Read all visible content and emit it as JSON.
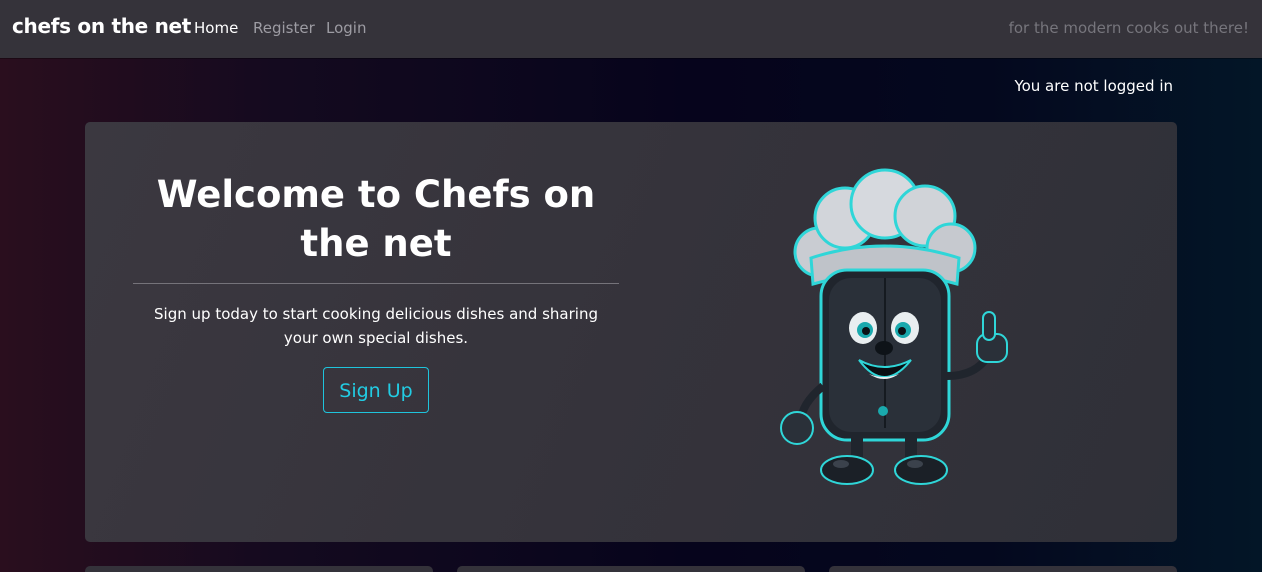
{
  "navbar": {
    "brand": "chefs on the net",
    "links": [
      {
        "label": "Home",
        "active": true
      },
      {
        "label": "Register",
        "active": false
      },
      {
        "label": "Login",
        "active": false
      }
    ],
    "tagline": "for the modern cooks out there!"
  },
  "status": {
    "login_text": "You are not logged in"
  },
  "hero": {
    "title": "Welcome to Chefs on the net",
    "subtitle": "Sign up today to start cooking delicious dishes and sharing your own special dishes.",
    "button_label": "Sign Up",
    "mascot_icon": "chef-mascot-icon"
  },
  "colors": {
    "navbar_bg": "#35333a",
    "accent": "#22cce3",
    "card_bg": "#35333b"
  }
}
